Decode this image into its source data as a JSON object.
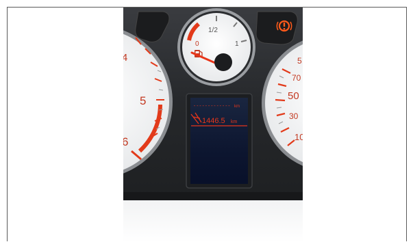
{
  "fuel_gauge": {
    "scale_empty": "0",
    "scale_half": "1/2",
    "scale_full": "1"
  },
  "tachometer": {
    "tick_4": "4",
    "tick_5": "5",
    "tick_6": "6"
  },
  "speedometer": {
    "tick_70": "70",
    "tick_50": "50",
    "tick_30": "30",
    "tick_10": "10",
    "tick_5": "5"
  },
  "display": {
    "dashes": "-------------",
    "unit_top": "km",
    "odometer_value": "1446.5",
    "odometer_unit": "km"
  },
  "colors": {
    "accent": "#e23a1a",
    "display_text": "#e8361a",
    "housing": "#2a2c2f"
  },
  "icons": {
    "warning_light": "parking-brake-icon",
    "fuel": "fuel-pump-icon",
    "trip": "road-icon"
  }
}
